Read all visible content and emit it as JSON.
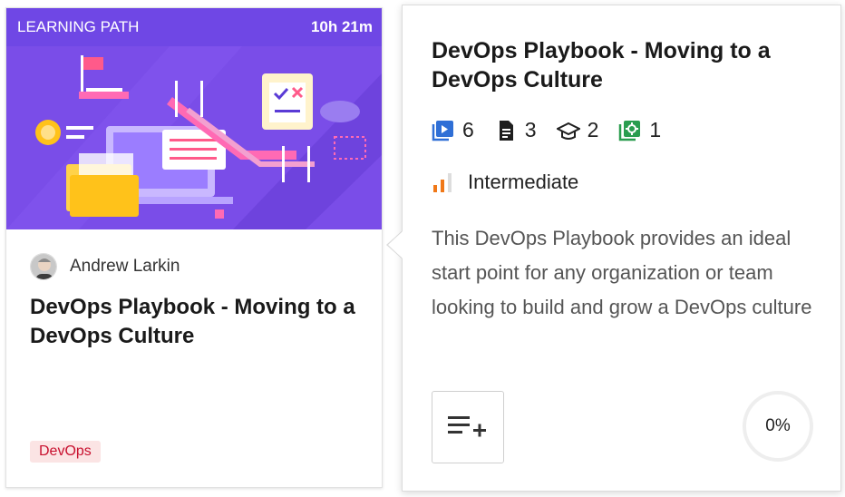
{
  "card": {
    "banner_type": "LEARNING PATH",
    "duration": "10h 21m",
    "author": "Andrew Larkin",
    "title": "DevOps Playbook - Moving to a DevOps Culture",
    "tag": "DevOps"
  },
  "popover": {
    "title": "DevOps Playbook - Moving to a DevOps Culture",
    "stats": [
      {
        "icon": "video-course-icon",
        "count": "6",
        "color": "#2f6fd6"
      },
      {
        "icon": "document-icon",
        "count": "3",
        "color": "#1f1f1f"
      },
      {
        "icon": "graduation-cap-icon",
        "count": "2",
        "color": "#1f1f1f"
      },
      {
        "icon": "lab-icon",
        "count": "1",
        "color": "#2a9d4f"
      }
    ],
    "level": "Intermediate",
    "level_color": "#f07818",
    "description": "This DevOps Playbook provides an ideal start point for any organization or team looking to build and grow a DevOps culture",
    "progress": "0%"
  },
  "colors": {
    "banner": "#6f47e5",
    "tag_bg": "#fbe4e4",
    "tag_text": "#c8102e"
  }
}
